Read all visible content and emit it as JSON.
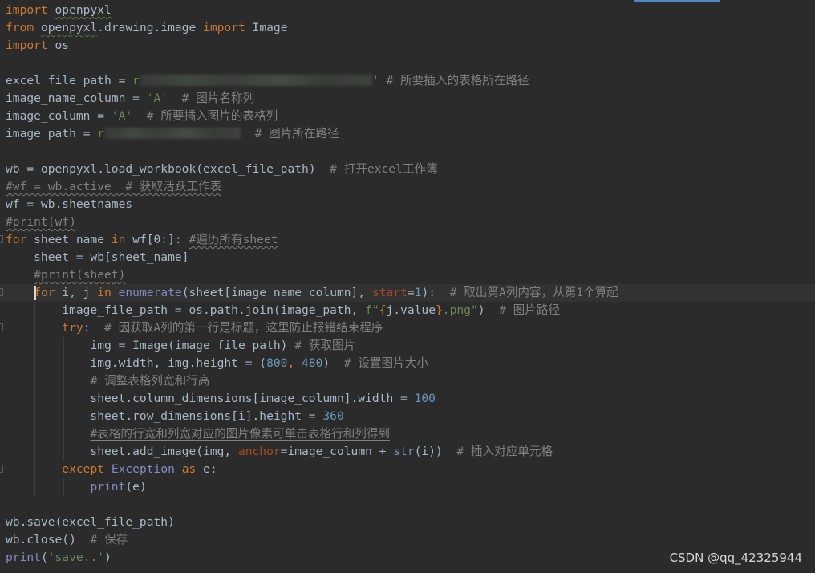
{
  "watermark": "CSDN @qq_42325944",
  "code_lines": [
    [
      [
        "kw",
        "import"
      ],
      [
        "id",
        " "
      ],
      [
        "id",
        "openpyxl",
        "wavy"
      ]
    ],
    [
      [
        "kw",
        "from"
      ],
      [
        "id",
        " "
      ],
      [
        "id",
        "openpyxl",
        "wavy"
      ],
      [
        "id",
        ".drawing.image "
      ],
      [
        "kw",
        "import"
      ],
      [
        "id",
        " Image"
      ]
    ],
    [
      [
        "kw",
        "import"
      ],
      [
        "id",
        " os"
      ]
    ],
    [],
    [
      [
        "id",
        "excel_file_path = "
      ],
      [
        "str",
        "r"
      ],
      [
        "blur",
        "",
        290
      ],
      [
        "str",
        "'"
      ],
      [
        "id",
        " "
      ],
      [
        "cmt",
        "# 所要插入的表格所在路径"
      ]
    ],
    [
      [
        "id",
        "image_name_column = "
      ],
      [
        "str",
        "'A'"
      ],
      [
        "id",
        "  "
      ],
      [
        "cmt",
        "# 图片名称列"
      ]
    ],
    [
      [
        "id",
        "image_column = "
      ],
      [
        "str",
        "'A'"
      ],
      [
        "id",
        "  "
      ],
      [
        "cmt",
        "# 所要插入图片的表格列"
      ]
    ],
    [
      [
        "id",
        "image_path = "
      ],
      [
        "str",
        "r"
      ],
      [
        "blur",
        "",
        170
      ],
      [
        "id",
        "  "
      ],
      [
        "cmt",
        "# 图片所在路径"
      ]
    ],
    [],
    [
      [
        "id",
        "wb = openpyxl.load_workbook(excel_file_path)  "
      ],
      [
        "cmt",
        "# 打开excel工作簿"
      ]
    ],
    [
      [
        "cmt",
        "#wf = wb.active  # 获取活跃工作表",
        "wavygray"
      ]
    ],
    [
      [
        "id",
        "wf = wb.sheetnames"
      ]
    ],
    [
      [
        "cmt",
        "#print(wf)",
        "wavygray"
      ]
    ],
    [
      [
        "kw",
        "for"
      ],
      [
        "id",
        " sheet_name "
      ],
      [
        "kw",
        "in"
      ],
      [
        "id",
        " wf[0:]: "
      ],
      [
        "cmt",
        "#遍历所有sheet",
        "wavygray"
      ]
    ],
    [
      [
        "id",
        "    sheet = wb[sheet_name]"
      ]
    ],
    [
      [
        "id",
        "    "
      ],
      [
        "cmt",
        "#print(sheet)",
        "wavygray"
      ]
    ],
    [
      [
        "id",
        "    "
      ],
      [
        "kw",
        "for"
      ],
      [
        "id",
        " i, j "
      ],
      [
        "kw",
        "in"
      ],
      [
        "id",
        " "
      ],
      [
        "fn",
        "enumerate"
      ],
      [
        "id",
        "(sheet[image_name_column], "
      ],
      [
        "param",
        "start"
      ],
      [
        "id",
        "="
      ],
      [
        "num",
        "1"
      ],
      [
        "id",
        "):  "
      ],
      [
        "cmt",
        "# 取出第A列内容，从第1个算起"
      ]
    ],
    [
      [
        "id",
        "        image_file_path = os.path.join(image_path, "
      ],
      [
        "str",
        "f\""
      ],
      [
        "brace",
        "{"
      ],
      [
        "id",
        "j.value"
      ],
      [
        "brace",
        "}"
      ],
      [
        "str",
        ".png\""
      ],
      [
        "id",
        ")  "
      ],
      [
        "cmt",
        "# 图片路径"
      ]
    ],
    [
      [
        "id",
        "        "
      ],
      [
        "kw",
        "try"
      ],
      [
        "id",
        ":  "
      ],
      [
        "cmt",
        "# 因获取A列的第一行是标题，这里防止报错结束程序"
      ]
    ],
    [
      [
        "id",
        "            img = Image(image_file_path) "
      ],
      [
        "cmt",
        "# 获取图片"
      ]
    ],
    [
      [
        "id",
        "            img.width, img.height = ("
      ],
      [
        "num",
        "800"
      ],
      [
        "kw",
        ", "
      ],
      [
        "num",
        "480"
      ],
      [
        "id",
        ")  "
      ],
      [
        "cmt",
        "# 设置图片大小"
      ]
    ],
    [
      [
        "id",
        "            "
      ],
      [
        "cmt",
        "# 调整表格列宽和行高"
      ]
    ],
    [
      [
        "id",
        "            sheet.column_dimensions[image_column].width = "
      ],
      [
        "num",
        "100"
      ]
    ],
    [
      [
        "id",
        "            sheet.row_dimensions[i].height = "
      ],
      [
        "num",
        "360"
      ]
    ],
    [
      [
        "id",
        "            "
      ],
      [
        "cmt",
        "#表格的行宽和列宽对应的图片像素可单击表格行和列得到",
        "underline"
      ]
    ],
    [
      [
        "id",
        "            sheet.add_image(img, "
      ],
      [
        "param",
        "anchor"
      ],
      [
        "id",
        "=image_column + "
      ],
      [
        "fn",
        "str"
      ],
      [
        "id",
        "(i))  "
      ],
      [
        "cmt",
        "# 插入对应单元格"
      ]
    ],
    [
      [
        "id",
        "        "
      ],
      [
        "kw",
        "except"
      ],
      [
        "id",
        " "
      ],
      [
        "fn",
        "Exception"
      ],
      [
        "id",
        " "
      ],
      [
        "kw",
        "as"
      ],
      [
        "id",
        " e:"
      ]
    ],
    [
      [
        "id",
        "            "
      ],
      [
        "fn",
        "print"
      ],
      [
        "id",
        "(e)"
      ]
    ],
    [],
    [
      [
        "id",
        "wb.save(excel_file_path)"
      ]
    ],
    [
      [
        "id",
        "wb.close()  "
      ],
      [
        "cmt",
        "# 保存"
      ]
    ],
    [
      [
        "fn",
        "print"
      ],
      [
        "id",
        "("
      ],
      [
        "str",
        "'save..'"
      ],
      [
        "id",
        ")"
      ]
    ]
  ]
}
